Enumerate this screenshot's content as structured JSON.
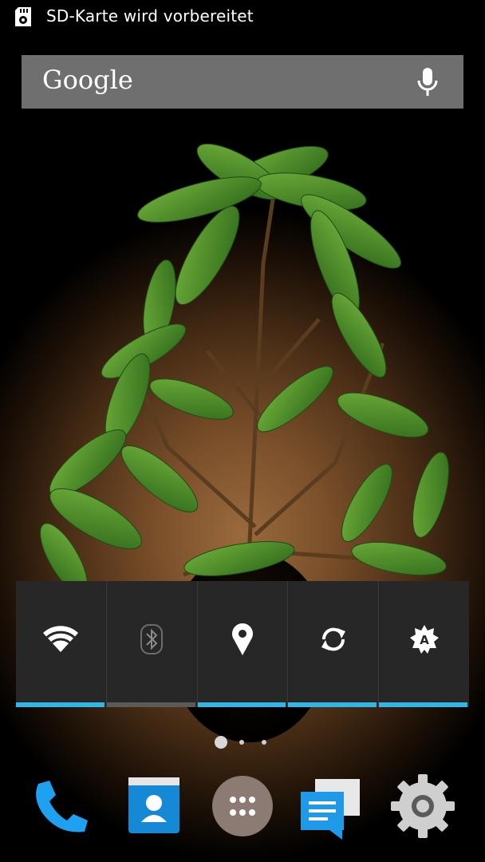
{
  "status_bar": {
    "notification_icon": "sd-card-icon",
    "text": "SD-Karte wird vorbereitet"
  },
  "search_widget": {
    "logo_text": "Google",
    "mic_icon": "mic-icon"
  },
  "quick_settings": {
    "accent_color": "#33b5e5",
    "tiles": [
      {
        "name": "wifi",
        "icon": "wifi-icon",
        "active": true
      },
      {
        "name": "bluetooth",
        "icon": "bluetooth-icon",
        "active": false
      },
      {
        "name": "location",
        "icon": "location-icon",
        "active": true
      },
      {
        "name": "sync",
        "icon": "sync-icon",
        "active": true
      },
      {
        "name": "brightness",
        "icon": "auto-brightness-icon",
        "active": true
      }
    ]
  },
  "home_pages": {
    "count": 3,
    "current": 1
  },
  "dock": {
    "apps": [
      {
        "name": "phone",
        "icon": "phone-icon"
      },
      {
        "name": "contacts",
        "icon": "contacts-icon"
      },
      {
        "name": "app-drawer",
        "icon": "app-drawer-icon"
      },
      {
        "name": "messaging",
        "icon": "messaging-icon"
      },
      {
        "name": "settings",
        "icon": "settings-icon"
      }
    ]
  }
}
